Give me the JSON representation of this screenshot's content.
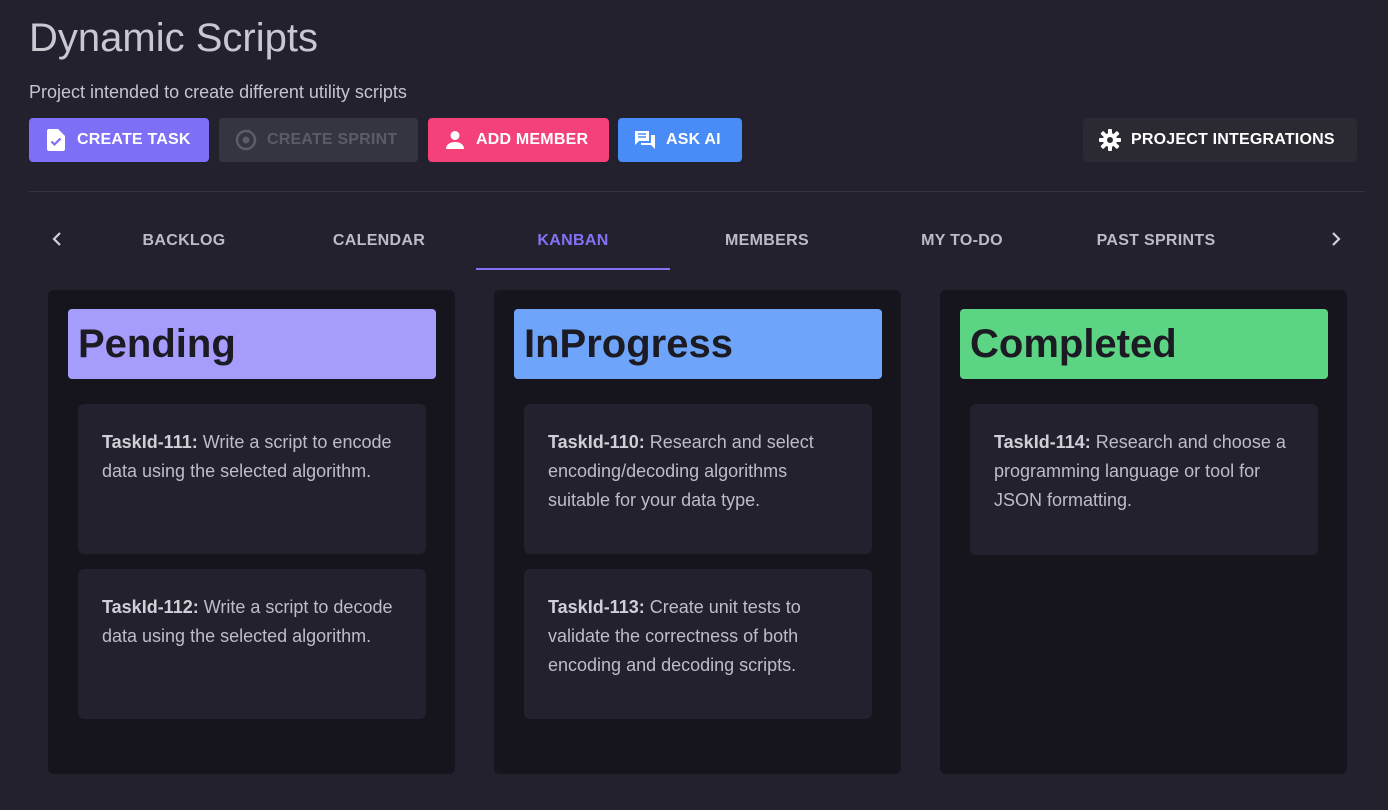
{
  "project": {
    "title": "Dynamic Scripts",
    "description": "Project intended to create different utility scripts"
  },
  "toolbar": {
    "create_task": "CREATE TASK",
    "create_sprint": "CREATE SPRINT",
    "add_member": "ADD MEMBER",
    "ask_ai": "ASK AI",
    "project_integrations": "PROJECT INTEGRATIONS"
  },
  "tabs": [
    {
      "label": "BACKLOG"
    },
    {
      "label": "CALENDAR"
    },
    {
      "label": "KANBAN",
      "active": true
    },
    {
      "label": "MEMBERS"
    },
    {
      "label": "MY TO-DO"
    },
    {
      "label": "PAST SPRINTS"
    }
  ],
  "columns": [
    {
      "title": "Pending",
      "color": "#a59cfb",
      "cards": [
        {
          "id": "TaskId-111:",
          "text": " Write a script to encode data using the selected algorithm."
        },
        {
          "id": "TaskId-112:",
          "text": " Write a script to decode data using the selected algorithm."
        }
      ]
    },
    {
      "title": "InProgress",
      "color": "#6ea5fb",
      "cards": [
        {
          "id": "TaskId-110:",
          "text": " Research and select encoding/decoding algorithms suitable for your data type."
        },
        {
          "id": "TaskId-113:",
          "text": " Create unit tests to validate the correctness of both encoding and decoding scripts."
        }
      ]
    },
    {
      "title": "Completed",
      "color": "#5bd484",
      "cards": [
        {
          "id": "TaskId-114:",
          "text": " Research and choose a programming language or tool for JSON formatting."
        }
      ]
    }
  ],
  "colors": {
    "accent": "#8272f5",
    "add_member": "#f4417a",
    "ask_ai": "#4a8cf7"
  },
  "icons": {
    "create_task": "task-file-icon",
    "create_sprint": "sprint-cycle-icon",
    "add_member": "person-icon",
    "ask_ai": "chat-bubbles-icon",
    "project_integrations": "gear-icon",
    "tabs_prev": "chevron-left-icon",
    "tabs_next": "chevron-right-icon"
  }
}
